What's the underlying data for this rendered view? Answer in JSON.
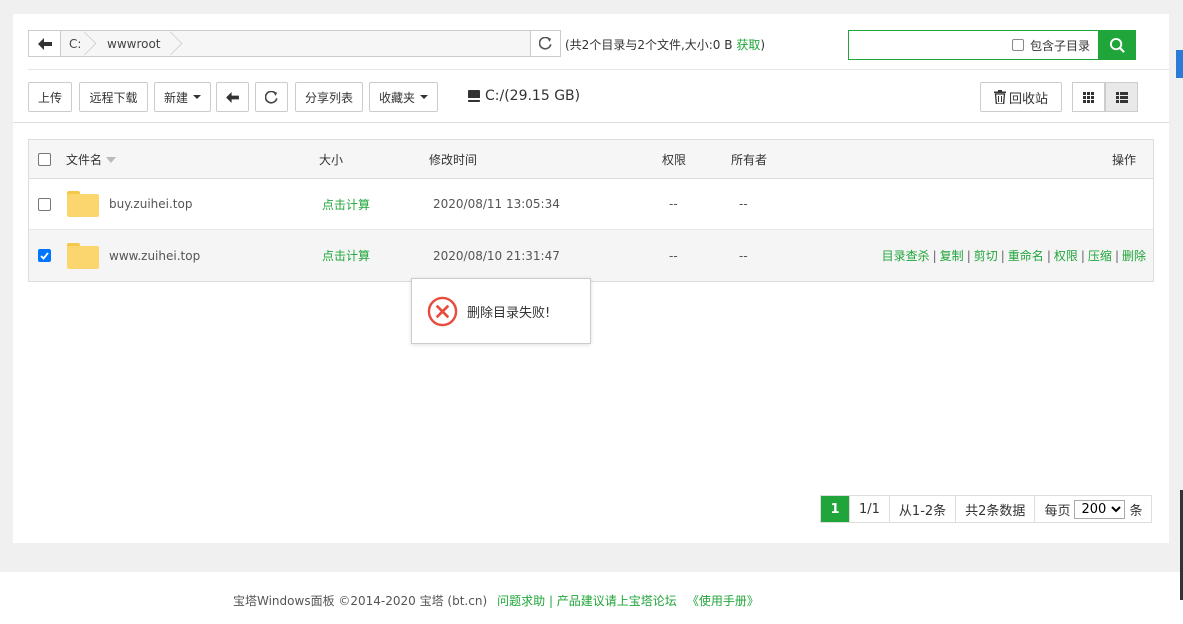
{
  "pathbar": {
    "segments": [
      "C:",
      "wwwroot"
    ],
    "dir_summary": "(共2个目录与2个文件,大小:0 B",
    "fetch_link": "获取",
    "close_paren": ")"
  },
  "search": {
    "include_subdirs_label": "包含子目录",
    "placeholder": ""
  },
  "toolbar": {
    "upload": "上传",
    "remote_download": "远程下载",
    "new": "新建",
    "share_list": "分享列表",
    "favorites": "收藏夹",
    "disk": "C:/(29.15 GB)",
    "recycle_bin": "回收站"
  },
  "table": {
    "headers": {
      "name": "文件名",
      "size": "大小",
      "mtime": "修改时间",
      "perm": "权限",
      "owner": "所有者",
      "ops": "操作"
    },
    "rows": [
      {
        "name": "buy.zuihei.top",
        "size": "点击计算",
        "mtime": "2020/08/11 13:05:34",
        "perm": "--",
        "owner": "--",
        "checked": false
      },
      {
        "name": "www.zuihei.top",
        "size": "点击计算",
        "mtime": "2020/08/10 21:31:47",
        "perm": "--",
        "owner": "--",
        "checked": true
      }
    ],
    "row_actions": [
      "目录查杀",
      "复制",
      "剪切",
      "重命名",
      "权限",
      "压缩",
      "删除"
    ]
  },
  "toast": {
    "message": "删除目录失败!"
  },
  "pager": {
    "current": "1",
    "pages": "1/1",
    "range": "从1-2条",
    "total": "共2条数据",
    "per_page_label": "每页",
    "per_page_value": "200",
    "per_page_unit": "条"
  },
  "footer": {
    "copyright": "宝塔Windows面板 ©2014-2020 宝塔 (bt.cn)",
    "help_link": "问题求助 | 产品建议请上宝塔论坛",
    "manual_link": "《使用手册》"
  },
  "colors": {
    "accent": "#20a53a",
    "error": "#e74c3c"
  }
}
